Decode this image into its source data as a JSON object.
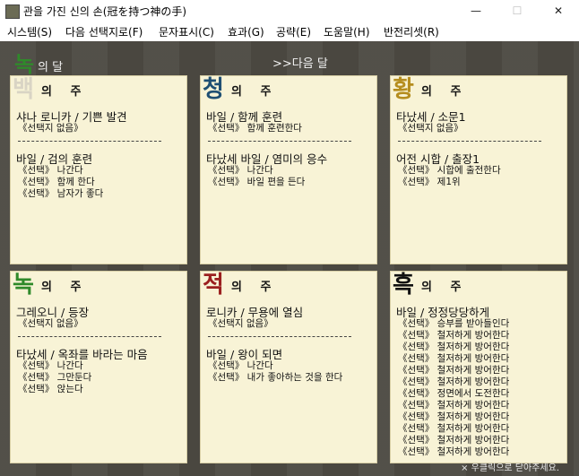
{
  "window": {
    "title": "관을 가진 신의 손(冠を持つ神の手)",
    "minimize": "—",
    "maximize": "☐",
    "close": "✕"
  },
  "menu": [
    "시스템(S)",
    "다음 선택지로(F)",
    "문자표시(C)",
    "효과(G)",
    "공략(E)",
    "도움말(H)",
    "반전리셋(R)"
  ],
  "header": {
    "month_char": "녹",
    "month_label": "의 달",
    "next_month": ">>다음 달"
  },
  "colors": {
    "white": "#d9d4c4",
    "blue": "#1f4f73",
    "yellow": "#b58d1e",
    "green": "#2f8a2a",
    "red": "#9b1f1f",
    "black": "#111111"
  },
  "panels": [
    {
      "char": "백",
      "suffix": "의 주",
      "color_key": "white",
      "event1": "샤나 로니카 / 기쁜 발견",
      "choices1": [
        "《선택지 없음》"
      ],
      "event2": "바일 / 검의 훈련",
      "choices2": [
        "《선택》 나간다",
        "《선택》 함께 한다",
        "《선택》 남자가 좋다"
      ]
    },
    {
      "char": "청",
      "suffix": "의 주",
      "color_key": "blue",
      "event1": "바일 / 함께 훈련",
      "choices1": [
        "《선택》 함께 훈련한다"
      ],
      "event2": "타났세 바일 / 염미의 응수",
      "choices2": [
        "《선택》 나간다",
        "《선택》 바일 편을 든다"
      ]
    },
    {
      "char": "황",
      "suffix": "의 주",
      "color_key": "yellow",
      "event1": "타났세 / 소문1",
      "choices1": [
        "《선택지 없음》"
      ],
      "event2": "어전 시합 / 출장1",
      "choices2": [
        "《선택》 시합에 출전한다",
        "《선택》 제1위"
      ]
    },
    {
      "char": "녹",
      "suffix": "의 주",
      "color_key": "green",
      "event1": "그레오니 / 등장",
      "choices1": [
        "《선택지 없음》"
      ],
      "event2": "타났세 / 옥좌를 바라는 마음",
      "choices2": [
        "《선택》 나간다",
        "《선택》 그만둔다",
        "《선택》 앉는다"
      ]
    },
    {
      "char": "적",
      "suffix": "의 주",
      "color_key": "red",
      "event1": "로니카 / 무용에 열심",
      "choices1": [
        "《선택지 없음》"
      ],
      "event2": "바일 / 왕이 되면",
      "choices2": [
        "《선택》 나간다",
        "《선택》 내가 좋아하는 것을 한다"
      ]
    },
    {
      "char": "흑",
      "suffix": "의 주",
      "color_key": "black",
      "event1": "바일 / 정정당당하게",
      "choices1": [
        "《선택》 승부를 받아들인다",
        "《선택》 철저하게 방어한다",
        "《선택》 철저하게 방어한다",
        "《선택》 철저하게 방어한다",
        "《선택》 철저하게 방어한다",
        "《선택》 철저하게 방어한다",
        "《선택》 정면에서 도전한다",
        "《선택》 철저하게 방어한다",
        "《선택》 철저하게 방어한다",
        "《선택》 철저하게 방어한다",
        "《선택》 철저하게 방어한다",
        "《선택》 철저하게 방어한다"
      ]
    }
  ],
  "footer_hint": "× 우클릭으로 닫아주세요."
}
